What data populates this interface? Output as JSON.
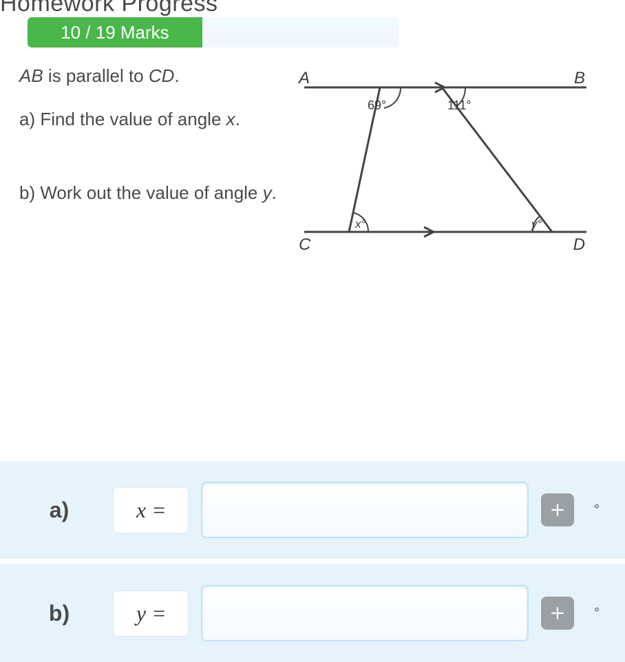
{
  "header": {
    "title": "Homework Progress",
    "marks_label": "10 / 19 Marks",
    "progress_percent": 47
  },
  "question": {
    "intro_html": "AB is parallel to CD.",
    "part_a": "a) Find the value of angle x.",
    "part_b": "b) Work out the value of angle y."
  },
  "diagram": {
    "labels": {
      "A": "A",
      "B": "B",
      "C": "C",
      "D": "D"
    },
    "angles": {
      "top_left": "69°",
      "top_right": "111°",
      "bottom_left": "x°",
      "bottom_right": "y°"
    }
  },
  "answers": [
    {
      "part": "a)",
      "var": "x",
      "eq": "=",
      "value": "",
      "unit": "°"
    },
    {
      "part": "b)",
      "var": "y",
      "eq": "=",
      "value": "",
      "unit": "°"
    }
  ]
}
